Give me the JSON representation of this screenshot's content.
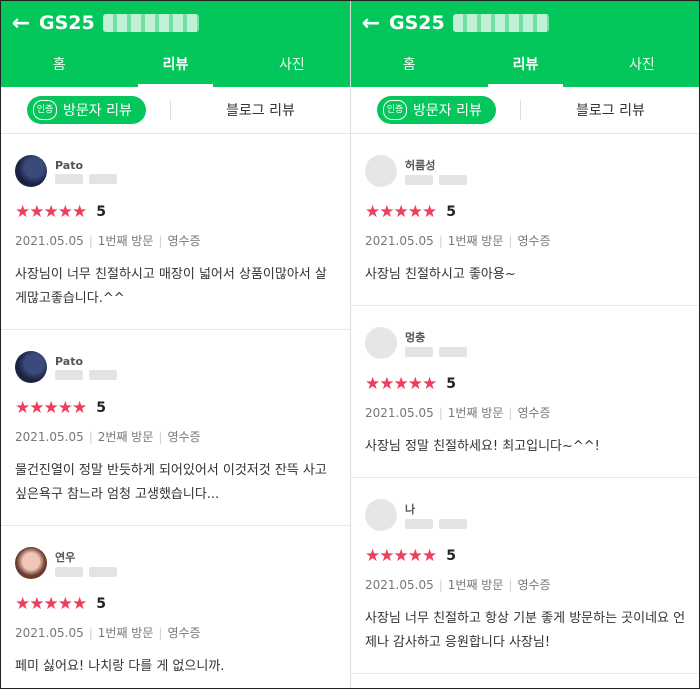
{
  "left": {
    "title": "GS25",
    "tabs": [
      "홈",
      "리뷰",
      "사진"
    ],
    "active_tab": 1,
    "subtabs": {
      "visitor": "방문자 리뷰",
      "badge": "인증",
      "blog": "블로그 리뷰"
    },
    "reviews": [
      {
        "name": "Pato",
        "rating": "5",
        "date": "2021.05.05",
        "visit": "1번째 방문",
        "receipt": "영수증",
        "text": "사장님이 너무 친절하시고 매장이 넓어서 상품이많아서 살게많고좋습니다.^^"
      },
      {
        "name": "Pato",
        "rating": "5",
        "date": "2021.05.05",
        "visit": "2번째 방문",
        "receipt": "영수증",
        "text": "물건진열이 정말 반듯하게 되어있어서 이것저것 잔뜩 사고싶은욕구 참느라 엄청 고생했습니다..."
      },
      {
        "name": "연우",
        "rating": "5",
        "date": "2021.05.05",
        "visit": "1번째 방문",
        "receipt": "영수증",
        "text": "페미 싫어요! 나치랑 다를 게 없으니까."
      }
    ]
  },
  "right": {
    "title": "GS25",
    "tabs": [
      "홈",
      "리뷰",
      "사진"
    ],
    "active_tab": 1,
    "subtabs": {
      "visitor": "방문자 리뷰",
      "badge": "인증",
      "blog": "블로그 리뷰"
    },
    "reviews": [
      {
        "name": "허름성",
        "rating": "5",
        "date": "2021.05.05",
        "visit": "1번째 방문",
        "receipt": "영수증",
        "text": "사장님 친절하시고 좋아용~"
      },
      {
        "name": "멍충",
        "rating": "5",
        "date": "2021.05.05",
        "visit": "1번째 방문",
        "receipt": "영수증",
        "text": "사장님 정말 친절하세요! 최고입니다~^^!"
      },
      {
        "name": "나",
        "rating": "5",
        "date": "2021.05.05",
        "visit": "1번째 방문",
        "receipt": "영수증",
        "text": "사장님 너무 친절하고 항상 기분 좋게 방문하는 곳이네요 언제나 감사하고 응원합니다 사장님!"
      }
    ]
  },
  "icons": {
    "back": "arrow-left-icon",
    "star": "star-icon"
  },
  "colors": {
    "brand": "#03c75a",
    "star": "#ef3e5b"
  }
}
